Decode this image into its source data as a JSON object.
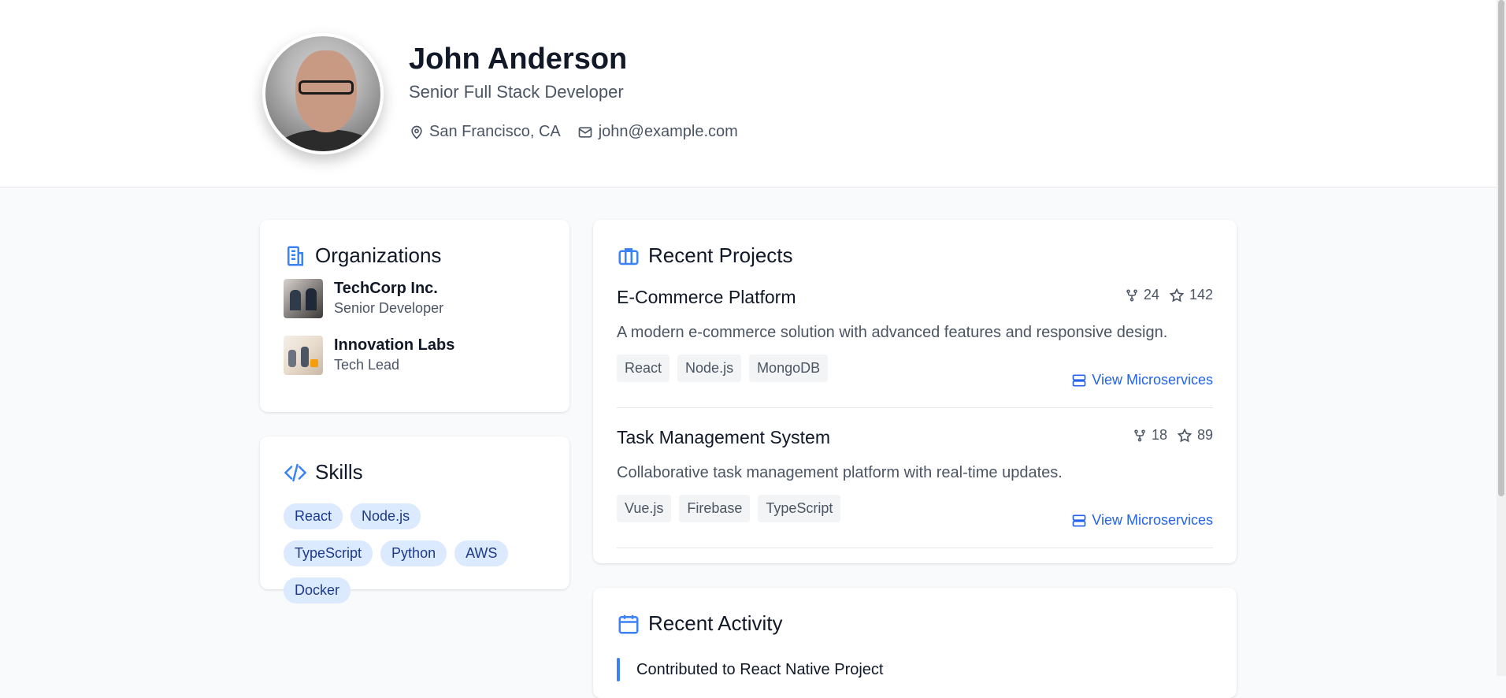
{
  "profile": {
    "name": "John Anderson",
    "title": "Senior Full Stack Developer",
    "location": "San Francisco, CA",
    "email": "john@example.com"
  },
  "organizations": {
    "heading": "Organizations",
    "items": [
      {
        "name": "TechCorp Inc.",
        "role": "Senior Developer"
      },
      {
        "name": "Innovation Labs",
        "role": "Tech Lead"
      }
    ]
  },
  "skills": {
    "heading": "Skills",
    "items": [
      "React",
      "Node.js",
      "TypeScript",
      "Python",
      "AWS",
      "Docker"
    ]
  },
  "projects": {
    "heading": "Recent Projects",
    "items": [
      {
        "name": "E-Commerce Platform",
        "description": "A modern e-commerce solution with advanced features and responsive design.",
        "forks": "24",
        "stars": "142",
        "tags": [
          "React",
          "Node.js",
          "MongoDB"
        ],
        "link_label": "View Microservices"
      },
      {
        "name": "Task Management System",
        "description": "Collaborative task management platform with real-time updates.",
        "forks": "18",
        "stars": "89",
        "tags": [
          "Vue.js",
          "Firebase",
          "TypeScript"
        ],
        "link_label": "View Microservices"
      }
    ]
  },
  "activity": {
    "heading": "Recent Activity",
    "items": [
      "Contributed to React Native Project"
    ]
  },
  "colors": {
    "accent": "#3b82f6",
    "link": "#2563eb",
    "skill_bg": "#dbeafe",
    "skill_text": "#1e3a8a"
  }
}
